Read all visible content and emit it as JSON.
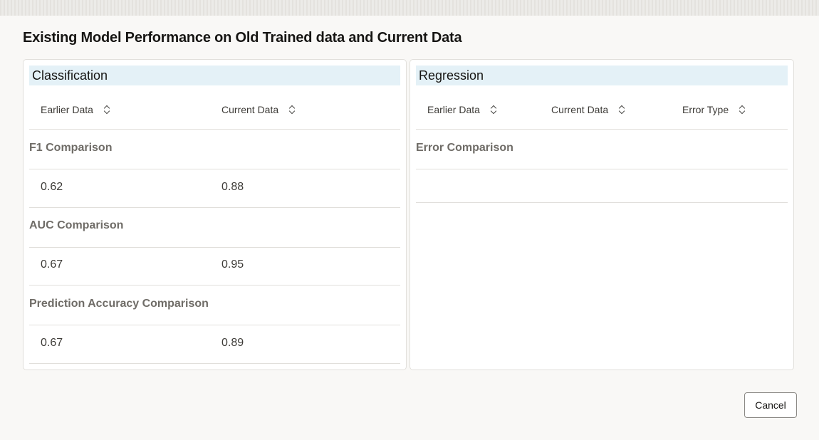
{
  "dialog": {
    "title": "Existing Model Performance on Old Trained data and Current Data",
    "cancel_label": "Cancel"
  },
  "classification": {
    "title": "Classification",
    "columns": [
      "Earlier Data",
      "Current Data"
    ],
    "groups": [
      {
        "label": "F1 Comparison",
        "earlier": "0.62",
        "current": "0.88"
      },
      {
        "label": "AUC Comparison",
        "earlier": "0.67",
        "current": "0.95"
      },
      {
        "label": "Prediction Accuracy Comparison",
        "earlier": "0.67",
        "current": "0.89"
      }
    ]
  },
  "regression": {
    "title": "Regression",
    "columns": [
      "Earlier Data",
      "Current Data",
      "Error Type"
    ],
    "groups": [
      {
        "label": "Error Comparison"
      }
    ]
  },
  "icons": {
    "sort": "sort-icon"
  }
}
